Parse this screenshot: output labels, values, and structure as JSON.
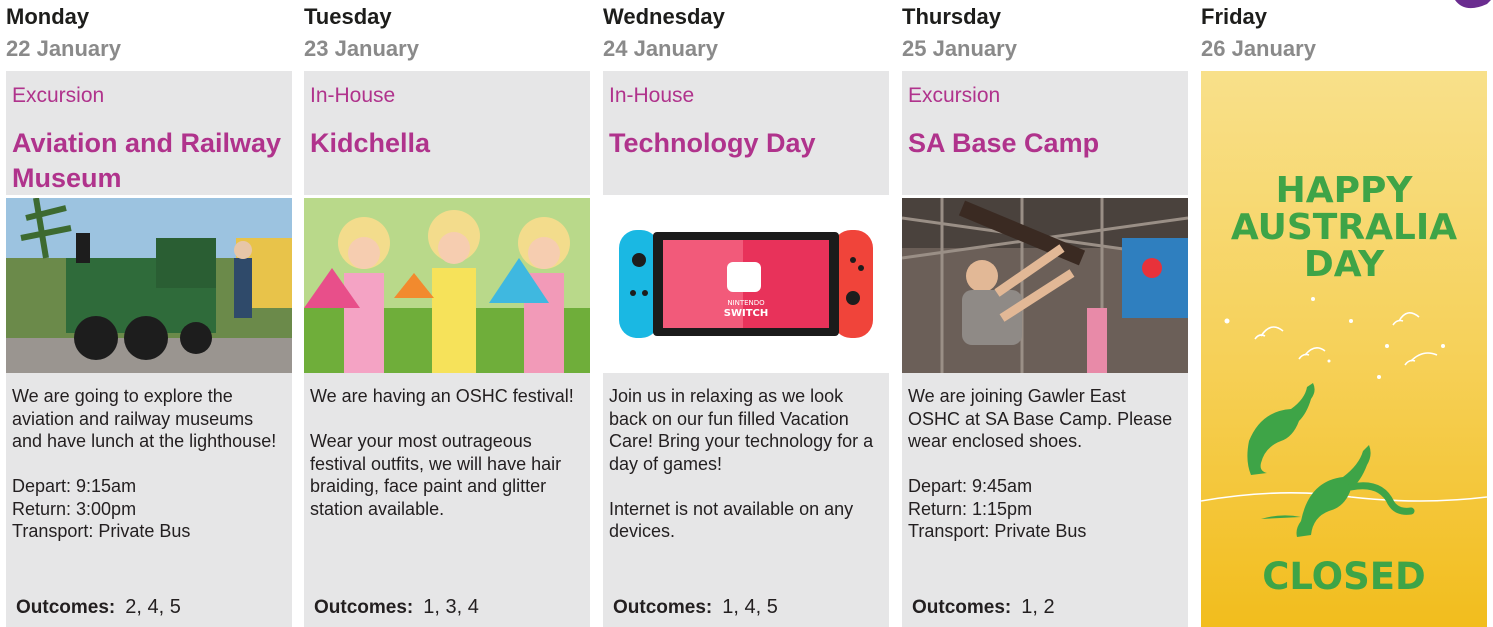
{
  "days": [
    {
      "day": "Monday",
      "date": "22 January",
      "kind": "Excursion",
      "title": "Aviation and Railway Museum",
      "description": "We are going to explore the aviation and railway museums and have lunch at the lighthouse!\n\nDepart: 9:15am\nReturn: 3:00pm\nTransport: Private Bus",
      "outcomes_label": "Outcomes:",
      "outcomes": "2, 4, 5"
    },
    {
      "day": "Tuesday",
      "date": "23 January",
      "kind": "In-House",
      "title": "Kidchella",
      "description": "We are having an OSHC festival!\n\nWear your most outrageous festival outfits, we will have hair braiding, face paint and glitter station available.",
      "outcomes_label": "Outcomes:",
      "outcomes": "1, 3, 4"
    },
    {
      "day": "Wednesday",
      "date": "24 January",
      "kind": "In-House",
      "title": "Technology Day",
      "description": "Join us in relaxing as we look back on our fun filled Vacation Care! Bring your technology for a day of games!\n\nInternet is not available on any devices.",
      "outcomes_label": "Outcomes:",
      "outcomes": "1, 4, 5"
    },
    {
      "day": "Thursday",
      "date": "25 January",
      "kind": "Excursion",
      "title": "SA Base Camp",
      "description": "We are joining Gawler East OSHC at SA Base Camp. Please wear enclosed shoes.\n\nDepart: 9:45am\nReturn: 1:15pm\nTransport: Private Bus",
      "outcomes_label": "Outcomes:",
      "outcomes": "1, 2"
    }
  ],
  "friday": {
    "day": "Friday",
    "date": "26 January",
    "happy_line1": "HAPPY",
    "happy_line2": "AUSTRALIA",
    "happy_line3": "DAY",
    "closed": "CLOSED"
  },
  "switch_brand_line1": "NINTENDO",
  "switch_brand_line2": "SWITCH",
  "colors": {
    "accent": "#b0338c",
    "panel": "#e6e6e7",
    "green": "#3ea447",
    "gold": "#f2bd1d"
  }
}
